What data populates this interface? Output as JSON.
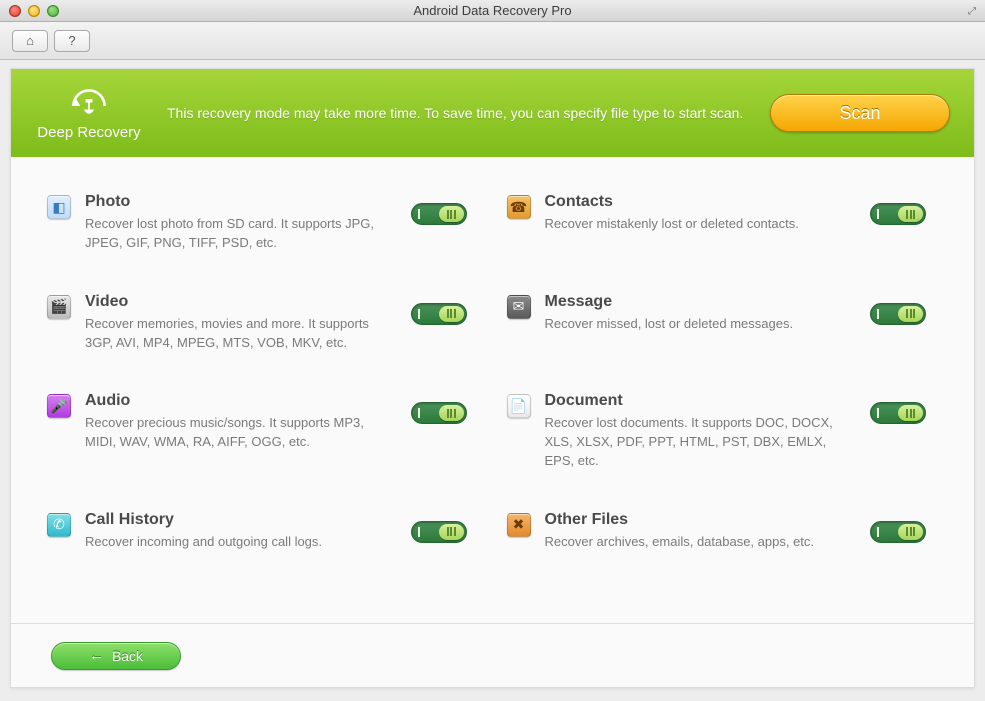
{
  "window": {
    "title": "Android Data Recovery Pro"
  },
  "banner": {
    "mode_label": "Deep Recovery",
    "message": "This recovery mode may take more time. To save time, you can specify file type to start scan.",
    "scan_label": "Scan"
  },
  "categories": [
    {
      "key": "photo",
      "icon": "photo-icon",
      "title": "Photo",
      "desc": "Recover lost photo from SD card. It supports JPG, JPEG, GIF, PNG, TIFF, PSD, etc.",
      "enabled": true,
      "bg": "linear-gradient(#dfefff,#bfdcf7)",
      "fg": "#3a7abf",
      "glyph": "◧"
    },
    {
      "key": "contacts",
      "icon": "contacts-icon",
      "title": "Contacts",
      "desc": "Recover mistakenly lost or deleted contacts.",
      "enabled": true,
      "bg": "linear-gradient(#f5c36b,#e39a2e)",
      "fg": "#6b3a00",
      "glyph": "☎"
    },
    {
      "key": "video",
      "icon": "video-icon",
      "title": "Video",
      "desc": "Recover memories, movies and more. It supports 3GP, AVI, MP4, MPEG, MTS, VOB, MKV, etc.",
      "enabled": true,
      "bg": "linear-gradient(#e7e7e7,#bcbcbc)",
      "fg": "#3a3a3a",
      "glyph": "🎬"
    },
    {
      "key": "message",
      "icon": "message-icon",
      "title": "Message",
      "desc": "Recover missed, lost or deleted messages.",
      "enabled": true,
      "bg": "linear-gradient(#8a8a8a,#5a5a5a)",
      "fg": "#ffffff",
      "glyph": "✉"
    },
    {
      "key": "audio",
      "icon": "audio-icon",
      "title": "Audio",
      "desc": "Recover precious music/songs. It supports MP3, MIDI, WAV, WMA, RA, AIFF, OGG, etc.",
      "enabled": true,
      "bg": "linear-gradient(#d680ef,#b23ae0)",
      "fg": "#ffffff",
      "glyph": "🎤"
    },
    {
      "key": "document",
      "icon": "document-icon",
      "title": "Document",
      "desc": "Recover lost documents. It supports DOC, DOCX, XLS, XLSX, PDF, PPT, HTML, PST, DBX, EMLX, EPS, etc.",
      "enabled": true,
      "bg": "linear-gradient(#ffffff,#e9e9e9)",
      "fg": "#9a9a9a",
      "glyph": "📄"
    },
    {
      "key": "callhistory",
      "icon": "call-history-icon",
      "title": "Call History",
      "desc": "Recover incoming and outgoing call logs.",
      "enabled": true,
      "bg": "linear-gradient(#7fe0e8,#2fb9cc)",
      "fg": "#ffffff",
      "glyph": "✆"
    },
    {
      "key": "other",
      "icon": "other-files-icon",
      "title": "Other Files",
      "desc": "Recover archives, emails, database, apps, etc.",
      "enabled": true,
      "bg": "linear-gradient(#f5b56b,#e38a2e)",
      "fg": "#6b3a00",
      "glyph": "✖"
    }
  ],
  "footer": {
    "back_label": "Back"
  }
}
